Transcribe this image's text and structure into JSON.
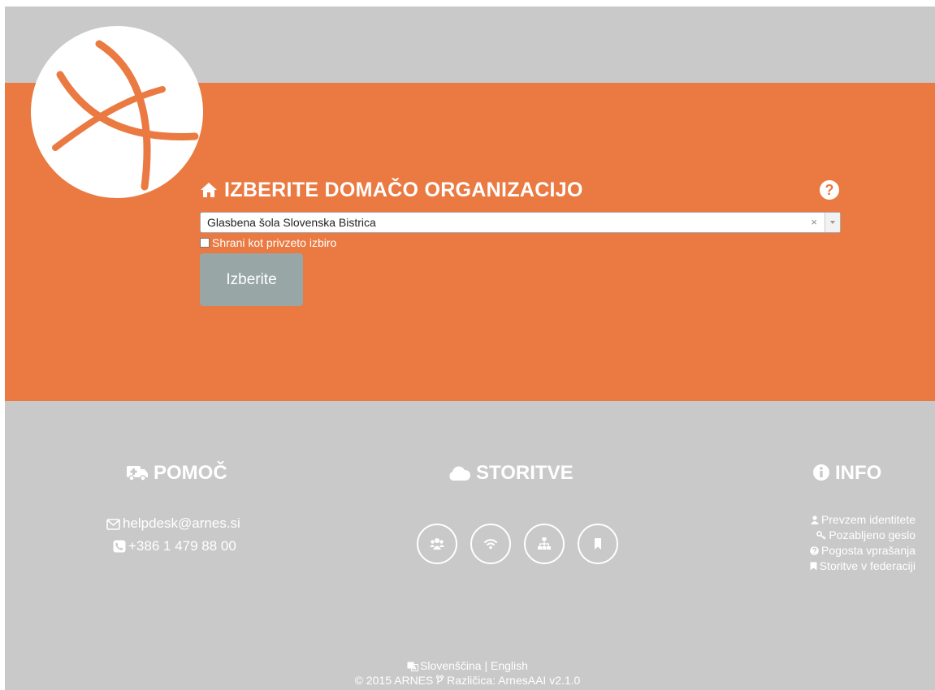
{
  "header": {
    "title": "IZBERITE DOMAČO ORGANIZACIJO",
    "help_symbol": "?"
  },
  "form": {
    "selected_organization": "Glasbena šola Slovenska Bistrica",
    "clear_symbol": "×",
    "remember_label": "Shrani kot privzeto izbiro",
    "remember_checked": false,
    "submit_label": "Izberite"
  },
  "footer": {
    "help": {
      "title": "POMOČ",
      "email": "helpdesk@arnes.si",
      "phone": "+386 1 479 88 00"
    },
    "services": {
      "title": "STORITVE",
      "icons": [
        "users-icon",
        "wifi-icon",
        "sitemap-icon",
        "bookmark-icon"
      ]
    },
    "info": {
      "title": "INFO",
      "links": [
        "Prevzem identitete",
        "Pozabljeno geslo",
        "Pogosta vprašanja",
        "Storitve v federaciji"
      ]
    },
    "languages": {
      "slovenian": "Slovenščina",
      "separator": "|",
      "english": "English"
    },
    "copyright": "© 2015 ARNES",
    "version": "Različica: ArnesAAI v2.1.0"
  },
  "colors": {
    "accent": "#ea7a42",
    "footer_bg": "#c9c9c9",
    "button_bg": "#99a6a6"
  }
}
